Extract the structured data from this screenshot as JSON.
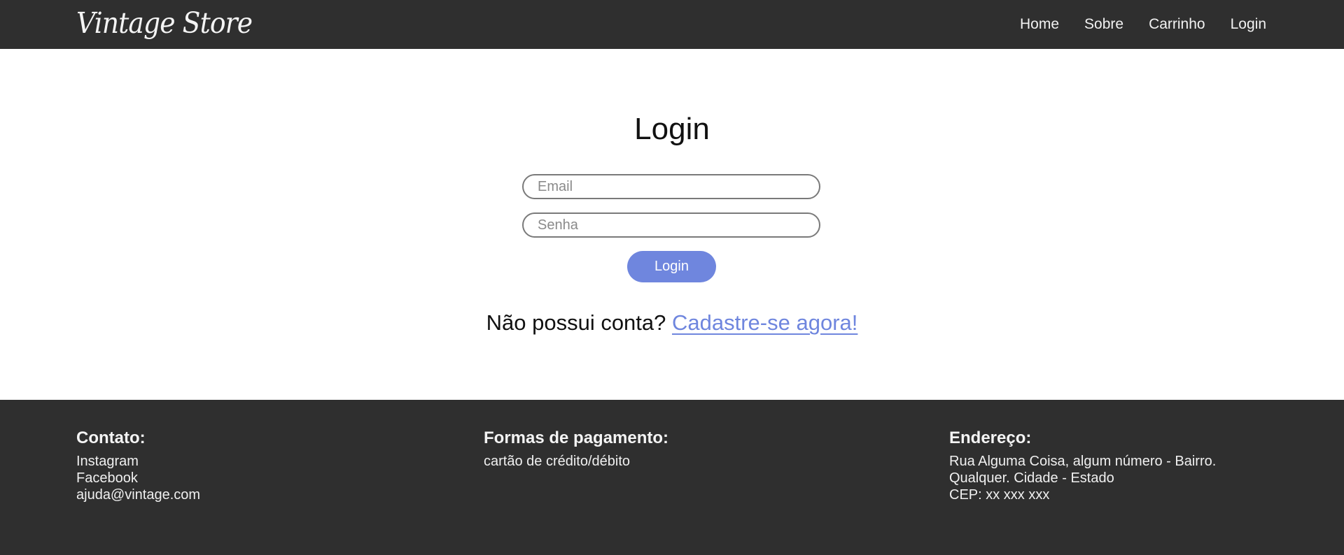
{
  "header": {
    "logo": "Vintage Store",
    "nav": [
      "Home",
      "Sobre",
      "Carrinho",
      "Login"
    ]
  },
  "main": {
    "title": "Login",
    "email_placeholder": "Email",
    "password_placeholder": "Senha",
    "login_button": "Login",
    "signup_prompt": "Não possui conta?",
    "signup_link": "Cadastre-se agora!"
  },
  "footer": {
    "contato": {
      "heading": "Contato:",
      "lines": [
        "Instagram",
        "Facebook",
        "ajuda@vintage.com"
      ]
    },
    "pagamento": {
      "heading": "Formas de pagamento:",
      "lines": [
        "cartão de crédito/débito"
      ]
    },
    "endereco": {
      "heading": "Endereço:",
      "lines": [
        "Rua Alguma Coisa, algum número - Bairro.",
        "Qualquer. Cidade - Estado",
        "CEP: xx xxx xxx"
      ]
    }
  },
  "colors": {
    "header_bg": "#2f2f2f",
    "accent": "#6f86de",
    "footer_bg": "#2f2f2f"
  }
}
